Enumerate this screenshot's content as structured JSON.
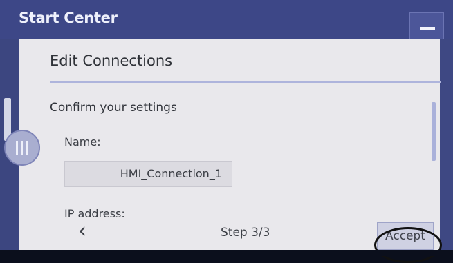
{
  "window": {
    "title": "Start Center"
  },
  "dialog": {
    "title": "Edit Connections",
    "section_heading": "Confirm your settings",
    "name_label": "Name:",
    "name_value": "HMI_Connection_1",
    "ip_label": "IP address:",
    "back_glyph": "‹",
    "step_text": "Step 3/3",
    "accept_label": "Accept"
  },
  "icons": {
    "minimize": "minimize-icon",
    "back": "chevron-left-icon",
    "handle": "drag-handle-icon"
  },
  "colors": {
    "titlebar": "#3d4787",
    "dialog_bg": "#e9e8ec",
    "accent_line": "#aeb4dc"
  }
}
